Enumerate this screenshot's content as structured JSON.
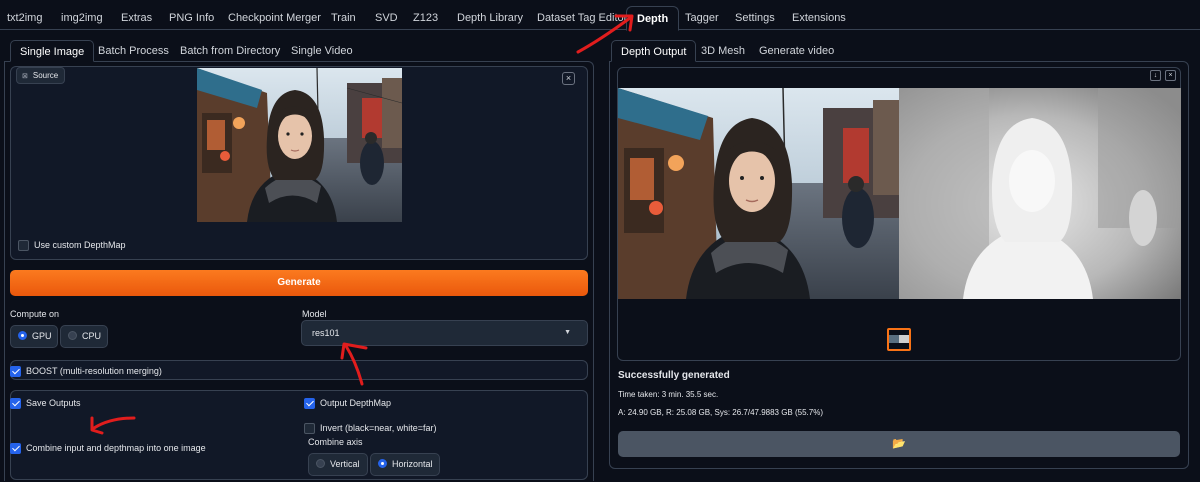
{
  "top_tabs": [
    {
      "label": "txt2img"
    },
    {
      "label": "img2img"
    },
    {
      "label": "Extras"
    },
    {
      "label": "PNG Info"
    },
    {
      "label": "Checkpoint Merger"
    },
    {
      "label": "Train"
    },
    {
      "label": "SVD"
    },
    {
      "label": "Z123"
    },
    {
      "label": "Depth Library"
    },
    {
      "label": "Dataset Tag Editor"
    },
    {
      "label": "Depth"
    },
    {
      "label": "Tagger"
    },
    {
      "label": "Settings"
    },
    {
      "label": "Extensions"
    }
  ],
  "left": {
    "tabs": [
      {
        "label": "Single Image"
      },
      {
        "label": "Batch Process"
      },
      {
        "label": "Batch from Directory"
      },
      {
        "label": "Single Video"
      }
    ],
    "source_label": "Source",
    "use_custom_depthmap": "Use custom DepthMap",
    "generate_label": "Generate",
    "compute_on_label": "Compute on",
    "compute_options": [
      {
        "label": "GPU",
        "selected": true
      },
      {
        "label": "CPU",
        "selected": false
      }
    ],
    "model_label": "Model",
    "model_value": "res101",
    "boost_label": "BOOST (multi-resolution merging)",
    "save_outputs_label": "Save Outputs",
    "output_depthmap_label": "Output DepthMap",
    "invert_label": "Invert (black=near, white=far)",
    "combine_label": "Combine input and depthmap into one image",
    "combine_axis_label": "Combine axis",
    "axis_options": [
      {
        "label": "Vertical",
        "selected": false
      },
      {
        "label": "Horizontal",
        "selected": true
      }
    ]
  },
  "right": {
    "tabs": [
      {
        "label": "Depth Output"
      },
      {
        "label": "3D Mesh"
      },
      {
        "label": "Generate video"
      }
    ],
    "status_title": "Successfully generated",
    "time_taken": "Time taken: 3 min. 35.5 sec.",
    "vram": "A: 24.90 GB, R: 25.08 GB, Sys: 26.7/47.9883 GB (55.7%)"
  },
  "colors": {
    "accent": "#f97316",
    "selection": "#2563eb",
    "annotation": "#e11d1d"
  }
}
